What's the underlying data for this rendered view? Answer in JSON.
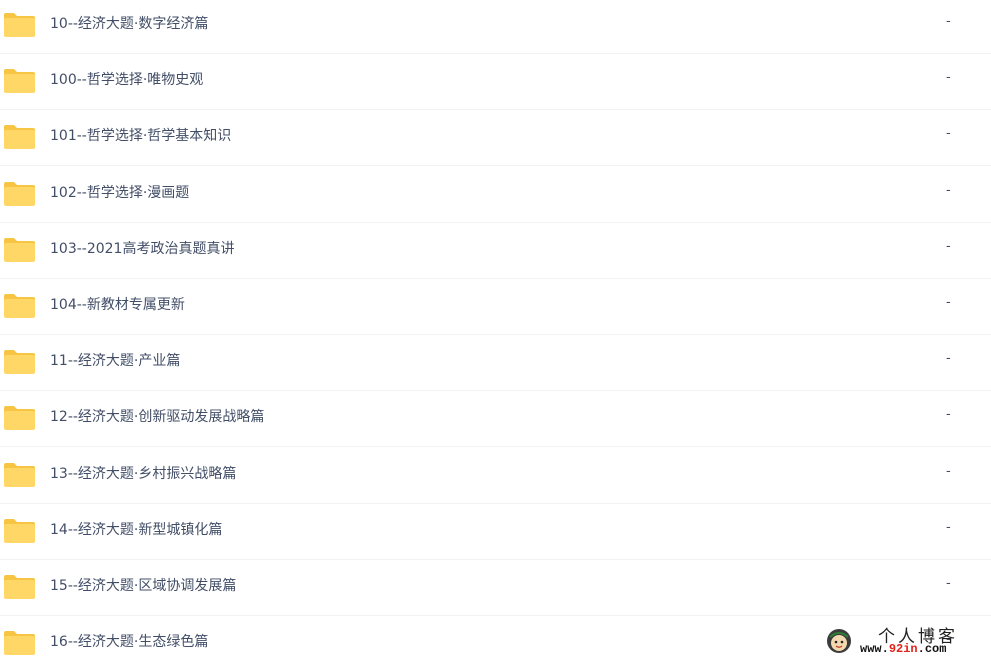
{
  "files": [
    {
      "name": "10--经济大题·数字经济篇",
      "size": "-"
    },
    {
      "name": "100--哲学选择·唯物史观",
      "size": "-"
    },
    {
      "name": "101--哲学选择·哲学基本知识",
      "size": "-"
    },
    {
      "name": "102--哲学选择·漫画题",
      "size": "-"
    },
    {
      "name": "103--2021高考政治真题真讲",
      "size": "-"
    },
    {
      "name": "104--新教材专属更新",
      "size": "-"
    },
    {
      "name": "11--经济大题·产业篇",
      "size": "-"
    },
    {
      "name": "12--经济大题·创新驱动发展战略篇",
      "size": "-"
    },
    {
      "name": "13--经济大题·乡村振兴战略篇",
      "size": "-"
    },
    {
      "name": "14--经济大题·新型城镇化篇",
      "size": "-"
    },
    {
      "name": "15--经济大题·区域协调发展篇",
      "size": "-"
    },
    {
      "name": "16--经济大题·生态绿色篇",
      "size": "-"
    }
  ],
  "icon": "folder-icon",
  "colors": {
    "text": "#424e67",
    "folder_body": "#ffd766",
    "folder_tab": "#f5c543",
    "row_divider": "#f1f2f4"
  },
  "watermark": {
    "cn_text": "个人博客",
    "url_prefix": "www.",
    "url_accent": "92in",
    "url_suffix": ".com"
  }
}
